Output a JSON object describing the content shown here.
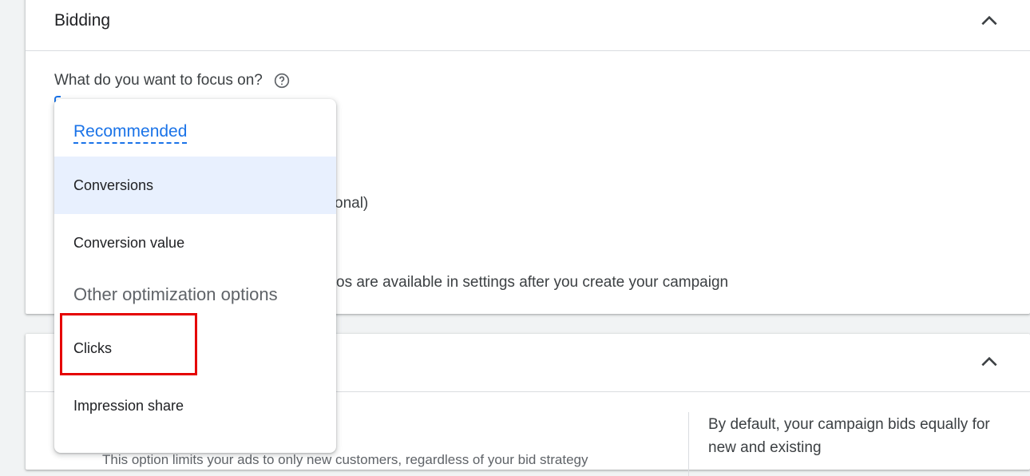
{
  "bidding_card": {
    "title": "Bidding",
    "focus_question": "What do you want to focus on?",
    "partial_text_1": "onal)",
    "partial_text_2": "os are available in settings after you create your campaign"
  },
  "second_card": {
    "right_note": "By default, your campaign bids equally for new and existing",
    "cut_text": "This option limits your ads to only new customers, regardless of your bid strategy"
  },
  "dropdown": {
    "recommended_heading": "Recommended",
    "recommended_items": [
      "Conversions",
      "Conversion value"
    ],
    "other_heading": "Other optimization options",
    "other_items": [
      "Clicks",
      "Impression share"
    ],
    "selected": "Conversions"
  },
  "icons": {
    "collapse": "chevron-up-icon",
    "help": "help-circle-icon"
  },
  "colors": {
    "accent": "#1a73e8",
    "selected_bg": "#e8f0fe",
    "annotation": "#e50000"
  }
}
